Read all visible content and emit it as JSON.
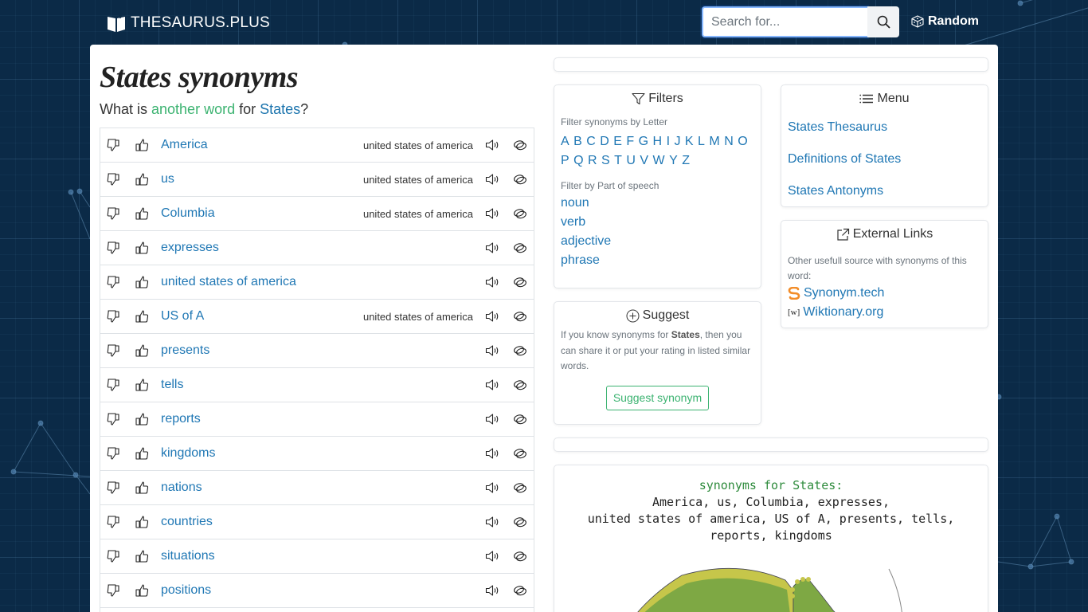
{
  "header": {
    "logo_text": "THESAURUS.PLUS",
    "search_placeholder": "Search for...",
    "random_label": "Random"
  },
  "main": {
    "title": "States synonyms",
    "subtitle": {
      "prefix": "What is ",
      "highlight": "another word",
      "middle": " for ",
      "word": "States",
      "suffix": "?"
    },
    "synonyms": [
      {
        "word": "America",
        "hint": "united states of america"
      },
      {
        "word": "us",
        "hint": "united states of america"
      },
      {
        "word": "Columbia",
        "hint": "united states of america"
      },
      {
        "word": "expresses",
        "hint": ""
      },
      {
        "word": "united states of america",
        "hint": ""
      },
      {
        "word": "US of A",
        "hint": "united states of america"
      },
      {
        "word": "presents",
        "hint": ""
      },
      {
        "word": "tells",
        "hint": ""
      },
      {
        "word": "reports",
        "hint": ""
      },
      {
        "word": "kingdoms",
        "hint": ""
      },
      {
        "word": "nations",
        "hint": ""
      },
      {
        "word": "countries",
        "hint": ""
      },
      {
        "word": "situations",
        "hint": ""
      },
      {
        "word": "positions",
        "hint": ""
      },
      {
        "word": "",
        "hint": ""
      }
    ]
  },
  "filters": {
    "title": "Filters",
    "letter_label": "Filter synonyms by Letter",
    "letters": [
      "A",
      "B",
      "C",
      "D",
      "E",
      "F",
      "G",
      "H",
      "I",
      "J",
      "K",
      "L",
      "M",
      "N",
      "O",
      "P",
      "Q",
      "R",
      "S",
      "T",
      "U",
      "V",
      "W",
      "Y",
      "Z"
    ],
    "pos_label": "Filter by Part of speech",
    "parts_of_speech": [
      "noun",
      "verb",
      "adjective",
      "phrase"
    ]
  },
  "suggest": {
    "title": "Suggest",
    "text_before": "If you know synonyms for ",
    "word": "States",
    "text_after": ", then you can share it or put your rating in listed similar words.",
    "button_label": "Suggest synonym"
  },
  "menu": {
    "title": "Menu",
    "items": [
      "States Thesaurus",
      "Definitions of States",
      "States Antonyms"
    ]
  },
  "external": {
    "title": "External Links",
    "text": "Other usefull source with synonyms of this word:",
    "links": [
      {
        "label": "Synonym.tech",
        "icon": "synonym-tech-logo"
      },
      {
        "label": "Wiktionary.org",
        "icon": "wiktionary-logo"
      }
    ]
  },
  "image_card": {
    "heading": "synonyms for States:",
    "lines": [
      "America, us, Columbia, expresses,",
      "united states of america, US of A, presents, tells,",
      "reports, kingdoms"
    ]
  },
  "colors": {
    "background": "#0b2a47",
    "link": "#1f77b4",
    "accent_green": "#3cb371"
  }
}
